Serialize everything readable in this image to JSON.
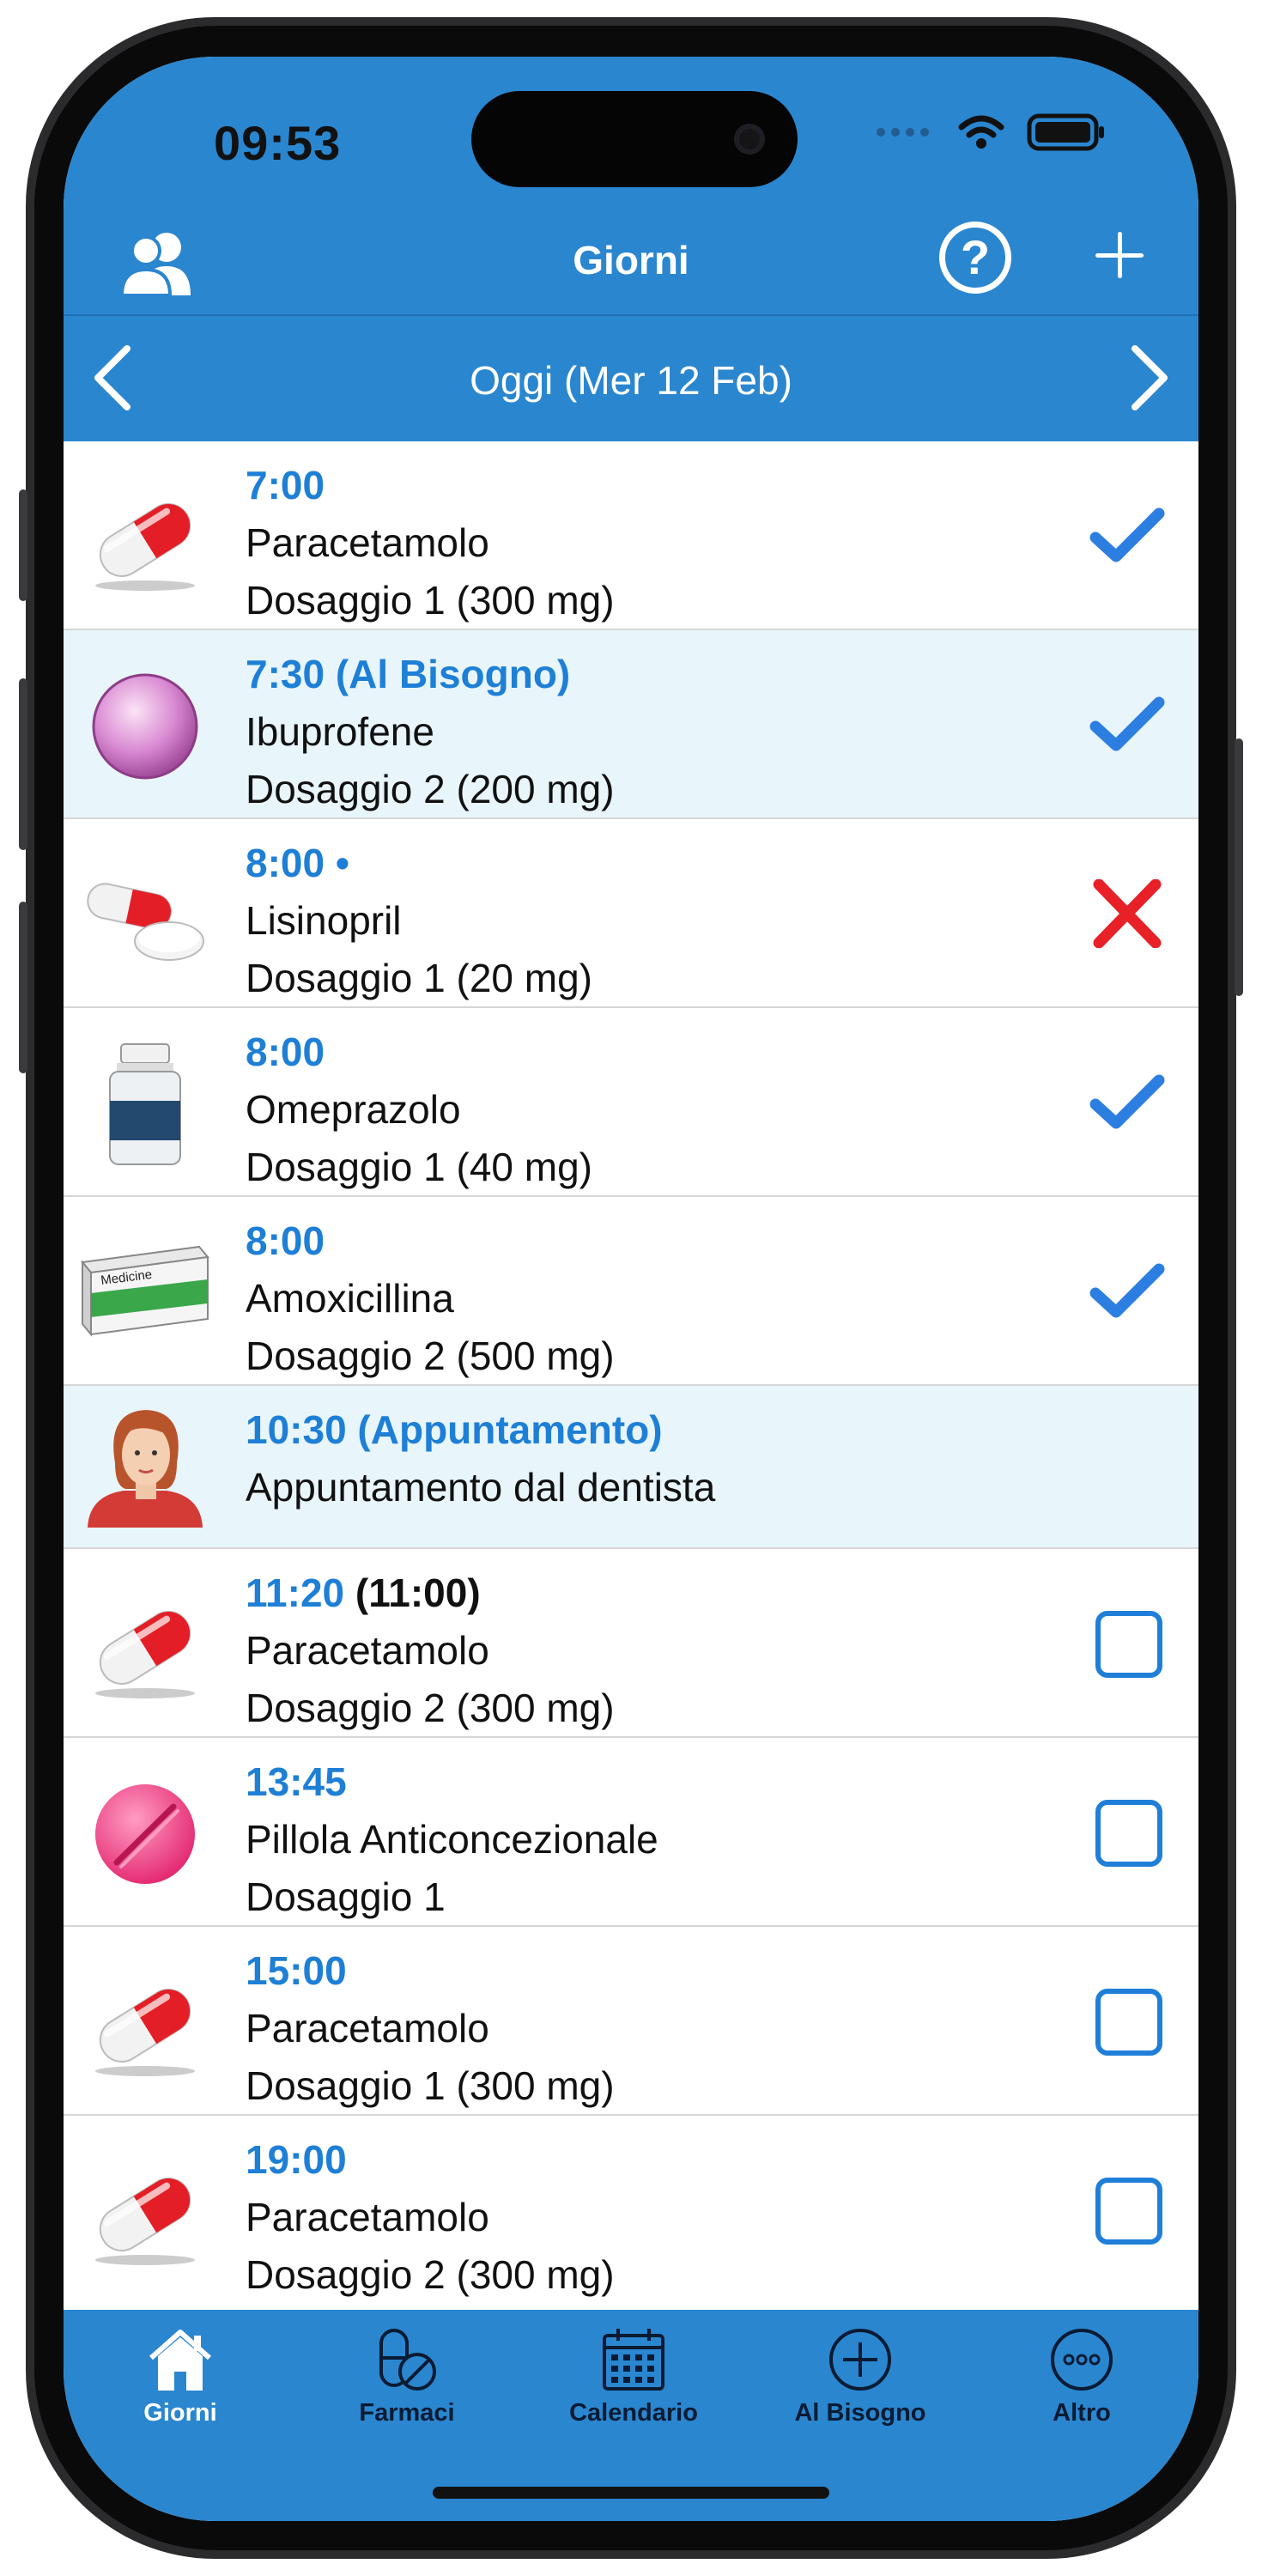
{
  "status_bar": {
    "time": "09:53"
  },
  "nav": {
    "title": "Giorni",
    "help_label": "?"
  },
  "date_bar": {
    "label": "Oggi (Mer 12 Feb)"
  },
  "rows": [
    {
      "time": "7:00",
      "name": "Paracetamolo",
      "dose": "Dosaggio 1 (300 mg)",
      "status": "taken",
      "icon": "capsule-icon"
    },
    {
      "time": "7:30 (Al Bisogno)",
      "name": "Ibuprofene",
      "dose": "Dosaggio 2 (200 mg)",
      "status": "taken",
      "icon": "pink-pearl-pill-icon"
    },
    {
      "time": "8:00 •",
      "name": "Lisinopril",
      "dose": "Dosaggio 1 (20 mg)",
      "status": "missed",
      "icon": "capsule-and-tablet-icon"
    },
    {
      "time": "8:00",
      "name": "Omeprazolo",
      "dose": "Dosaggio 1 (40 mg)",
      "status": "taken",
      "icon": "pill-bottle-icon"
    },
    {
      "time": "8:00",
      "name": "Amoxicillina",
      "dose": "Dosaggio 2 (500 mg)",
      "status": "taken",
      "icon": "medicine-box-icon",
      "box_text": "Medicine"
    },
    {
      "time": "10:30 (Appuntamento)",
      "name": "Appuntamento dal dentista",
      "icon": "woman-avatar-icon"
    },
    {
      "time": "11:20",
      "time_orig": "(11:00)",
      "name": "Paracetamolo",
      "dose": "Dosaggio 2 (300 mg)",
      "status": "pending",
      "icon": "capsule-icon"
    },
    {
      "time": "13:45",
      "name": "Pillola Anticoncezionale",
      "dose": "Dosaggio 1",
      "status": "pending",
      "icon": "pink-tablet-icon"
    },
    {
      "time": "15:00",
      "name": "Paracetamolo",
      "dose": "Dosaggio 1 (300 mg)",
      "status": "pending",
      "icon": "capsule-icon"
    },
    {
      "time": "19:00",
      "name": "Paracetamolo",
      "dose": "Dosaggio 2 (300 mg)",
      "status": "pending",
      "icon": "capsule-icon"
    }
  ],
  "tabs": [
    {
      "label": "Giorni",
      "icon": "house-icon",
      "active": true
    },
    {
      "label": "Farmaci",
      "icon": "pills-icon"
    },
    {
      "label": "Calendario",
      "icon": "calendar-icon"
    },
    {
      "label": "Al Bisogno",
      "icon": "circle-plus-icon"
    },
    {
      "label": "Altro",
      "icon": "circle-ellipsis-icon"
    }
  ],
  "colors": {
    "primary": "#2a86cf",
    "time_blue": "#1e7fd6",
    "alt_row": "#e8f5fb",
    "missed_red": "#e82028"
  }
}
